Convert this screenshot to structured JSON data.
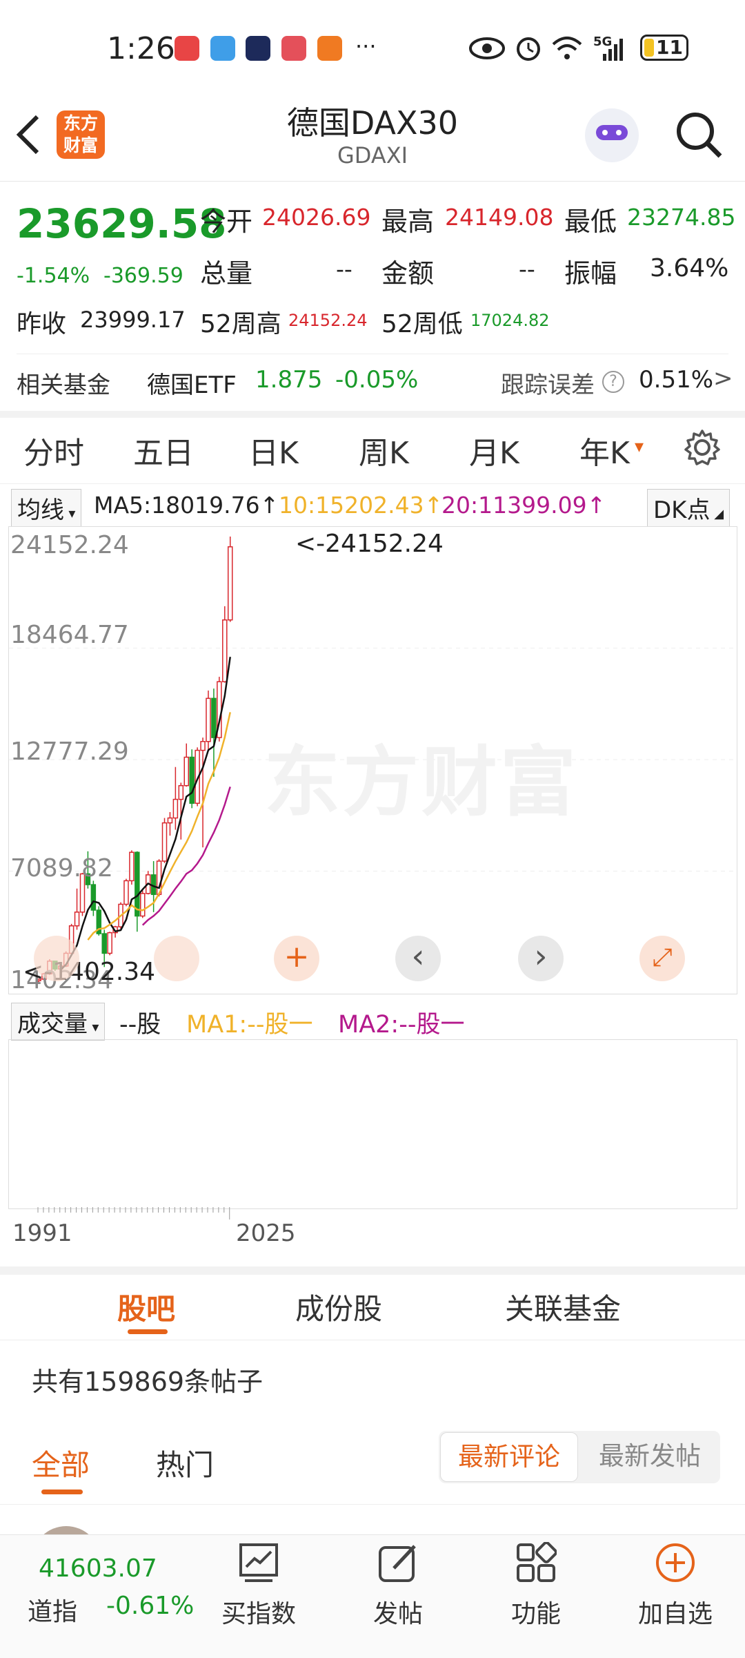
{
  "status_bar": {
    "time": "1:26",
    "more": "···",
    "network": "5G",
    "battery": "11"
  },
  "header": {
    "title": "德国DAX30",
    "subtitle": "GDAXI",
    "logo_text": "东方财富"
  },
  "quote": {
    "price": "23629.58",
    "change_pct": "-1.54%",
    "change_abs": "-369.59",
    "open_label": "今开",
    "open": "24026.69",
    "high_label": "最高",
    "high": "24149.08",
    "low_label": "最低",
    "low": "23274.85",
    "volume_label": "总量",
    "volume": "--",
    "amount_label": "金额",
    "amount": "--",
    "amplitude_label": "振幅",
    "amplitude": "3.64%",
    "prev_close_label": "昨收",
    "prev_close": "23999.17",
    "wk52_high_label": "52周高",
    "wk52_high": "24152.24",
    "wk52_low_label": "52周低",
    "wk52_low": "17024.82"
  },
  "related_fund": {
    "label": "相关基金",
    "name": "德国ETF",
    "price": "1.875",
    "change": "-0.05%",
    "tracking_label": "跟踪误差",
    "tracking_value": "0.51%",
    "arrow": ">"
  },
  "period_tabs": [
    "分时",
    "五日",
    "日K",
    "周K",
    "月K",
    "年K"
  ],
  "active_tab_arrow": "▾",
  "indicators": {
    "selector": "均线",
    "ma5": "MA5:18019.76↑",
    "ma10": "10:15202.43↑",
    "ma20": "20:11399.09↑",
    "dk": "DK点"
  },
  "chart_axis": {
    "y_labels": [
      "24152.24",
      "18464.77",
      "12777.29",
      "7089.82",
      "1402.34"
    ],
    "max_marker": "<-24152.24",
    "min_marker": "<-1402.34"
  },
  "chart_data": {
    "type": "candlestick",
    "period": "yearly",
    "x_start": "1991",
    "x_end": "2025",
    "ylim": [
      1402.34,
      24152.24
    ],
    "max_value": 24152.24,
    "min_value": 1402.34,
    "series": [
      {
        "name": "MA5",
        "value": 18019.76
      },
      {
        "name": "10",
        "value": 15202.43
      },
      {
        "name": "20",
        "value": 11399.09
      }
    ],
    "candles": [
      [
        1500,
        1600,
        1400,
        1580
      ],
      [
        1580,
        1900,
        1550,
        1850
      ],
      [
        1850,
        2600,
        1800,
        2500
      ],
      [
        2500,
        2450,
        2000,
        2100
      ],
      [
        2100,
        2300,
        2050,
        2250
      ],
      [
        2250,
        3000,
        2200,
        2900
      ],
      [
        2900,
        4400,
        2850,
        4300
      ],
      [
        4300,
        6200,
        4100,
        5000
      ],
      [
        5000,
        7000,
        4800,
        6950
      ],
      [
        6950,
        8100,
        6200,
        6400
      ],
      [
        6400,
        6600,
        4800,
        5100
      ],
      [
        5100,
        5300,
        3800,
        3900
      ],
      [
        3900,
        4100,
        2200,
        2900
      ],
      [
        2900,
        4000,
        2800,
        3950
      ],
      [
        3950,
        4300,
        3700,
        4250
      ],
      [
        4250,
        5500,
        4150,
        5400
      ],
      [
        5400,
        6700,
        5300,
        6600
      ],
      [
        6600,
        8150,
        6400,
        8050
      ],
      [
        8050,
        8100,
        4000,
        4800
      ],
      [
        4800,
        6100,
        4700,
        5950
      ],
      [
        5950,
        7100,
        5900,
        6900
      ],
      [
        6900,
        7600,
        5000,
        5900
      ],
      [
        5900,
        7700,
        5800,
        7600
      ],
      [
        7600,
        9800,
        7500,
        9550
      ],
      [
        9550,
        10100,
        8900,
        9800
      ],
      [
        9800,
        12400,
        9200,
        10750
      ],
      [
        10750,
        11600,
        8700,
        11450
      ],
      [
        11450,
        13600,
        11400,
        12900
      ],
      [
        12900,
        13300,
        10300,
        10550
      ],
      [
        10550,
        13400,
        10400,
        13250
      ],
      [
        13250,
        13900,
        8300,
        13700
      ],
      [
        13700,
        16300,
        13200,
        15900
      ],
      [
        15900,
        16400,
        11900,
        13900
      ],
      [
        13900,
        17000,
        13700,
        16750
      ],
      [
        16750,
        20600,
        16700,
        19900
      ],
      [
        19900,
        24152.24,
        19800,
        23629.58
      ]
    ]
  },
  "chart_controls": {
    "plus": "+",
    "prev": "‹",
    "next": "›",
    "expand": "⤢"
  },
  "volume_panel": {
    "selector": "成交量",
    "value": "--股",
    "ma1": "MA1:--股一",
    "ma2": "MA2:--股一"
  },
  "x_axis": {
    "start": "1991",
    "end": "2025"
  },
  "watermark": "东方财富",
  "community_tabs": [
    "股吧",
    "成份股",
    "关联基金"
  ],
  "posts": {
    "count_text": "共有159869条帖子"
  },
  "filter_tabs": [
    "全部",
    "热门"
  ],
  "sort_buttons": [
    "最新评论",
    "最新发帖"
  ],
  "bottom_nav": {
    "index_value": "41603.07",
    "index_name": "道指",
    "index_change": "-0.61%",
    "buy_index": "买指数",
    "post": "发帖",
    "function": "功能",
    "add": "加自选"
  },
  "colors": {
    "up": "#d8262c",
    "down": "#1a9a2a",
    "accent": "#e5631a",
    "ma5": "#111111",
    "ma10": "#f0b22a",
    "ma20": "#b4198c"
  }
}
